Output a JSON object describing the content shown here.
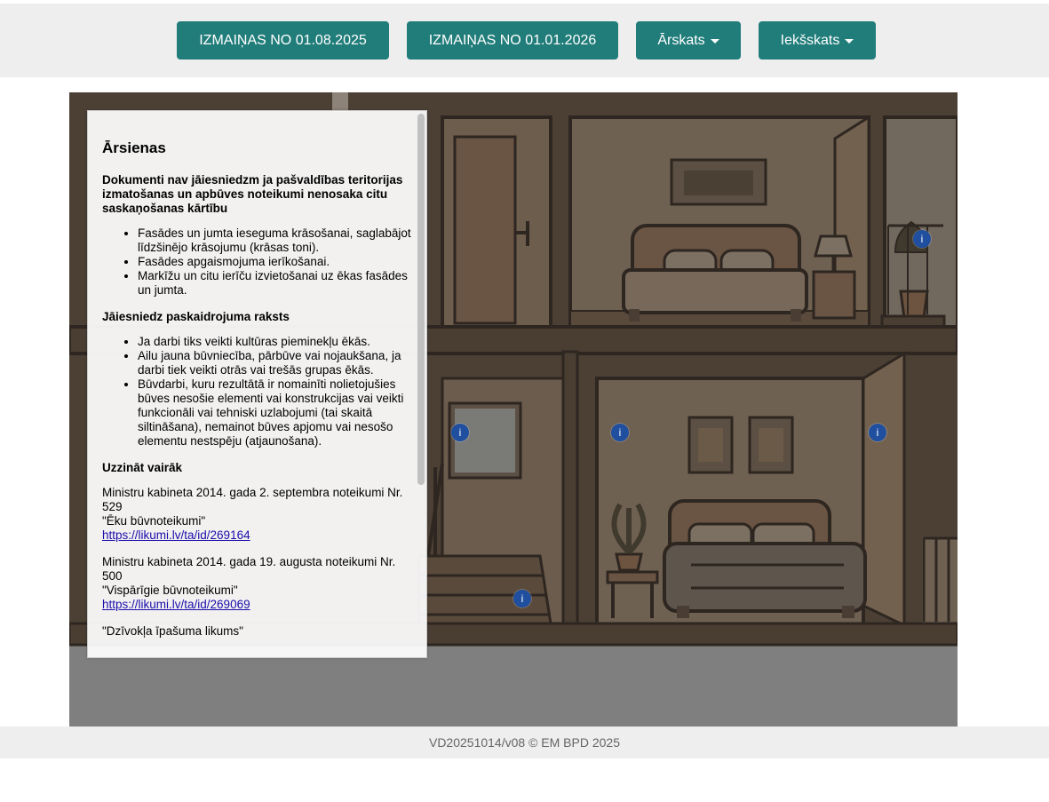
{
  "nav": {
    "btn1": "IZMAIŅAS NO 01.08.2025",
    "btn2": "IZMAIŅAS NO 01.01.2026",
    "btn3": "Ārskats",
    "btn4": "Iekšskats"
  },
  "hotspots": {
    "label": "i"
  },
  "panel": {
    "title": "Ārsienas",
    "section1": {
      "heading": "Dokumenti nav jāiesniedzm ja pašvaldības teritorijas izmatošanas un apbūves noteikumi nenosaka citu saskaņošanas kārtību",
      "items": [
        "Fasādes un jumta ieseguma krāsošanai, saglabājot līdzšinējo krāsojumu (krāsas toni).",
        "Fasādes apgaismojuma ierīkošanai.",
        "Markīžu un citu ierīču izvietošanai uz ēkas fasādes un jumta."
      ]
    },
    "section2": {
      "heading": "Jāiesniedz paskaidrojuma raksts",
      "items": [
        "Ja darbi tiks veikti kultūras pieminekļu ēkās.",
        "Ailu jauna būvniecība, pārbūve vai nojaukšana, ja darbi tiek veikti otrās vai trešās grupas ēkās.",
        "Būvdarbi, kuru rezultātā ir nomainīti nolietojušies būves nesošie elementi vai konstrukcijas vai veikti funkcionāli vai tehniski uzlabojumi (tai skaitā siltināšana), nemainot būves apjomu vai nesošo elementu nestspēju (atjaunošana)."
      ]
    },
    "section3": {
      "heading": "Uzzināt vairāk",
      "refs": [
        {
          "text": "Ministru kabineta 2014. gada 2. septembra noteikumi Nr. 529",
          "name": "\"Ēku būvnoteikumi\"",
          "link": "https://likumi.lv/ta/id/269164"
        },
        {
          "text": "Ministru kabineta 2014. gada 19. augusta noteikumi Nr. 500",
          "name": "\"Vispārīgie būvnoteikumi\"",
          "link": "https://likumi.lv/ta/id/269069"
        }
      ],
      "last": "\"Dzīvokļa īpašuma likums\""
    }
  },
  "footer": {
    "text": "VD20251014/v08 © EM BPD 2025"
  },
  "colors": {
    "accent": "#217d7a",
    "hotspot": "#1f4f9e",
    "wall": "#4a3e33"
  }
}
